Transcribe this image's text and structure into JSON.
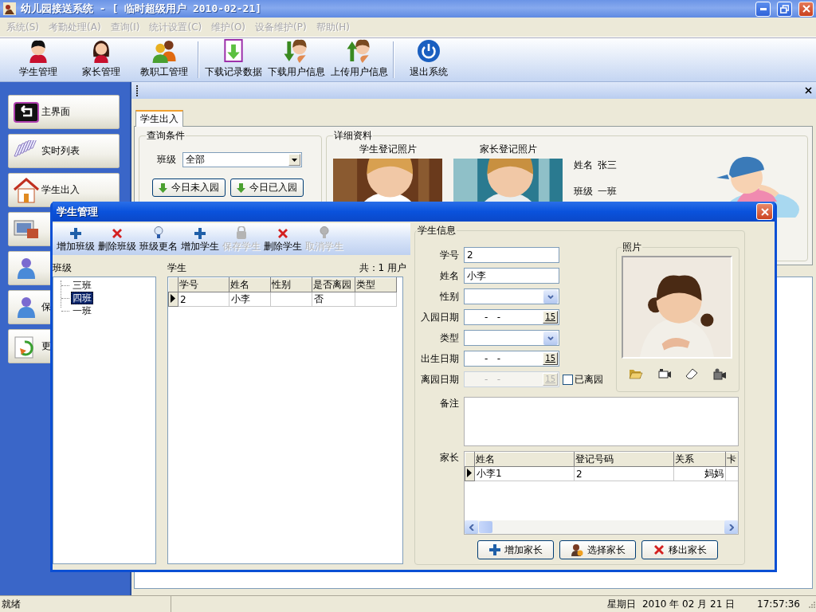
{
  "window": {
    "title": "幼儿园接送系统 - [ 临时超级用户 2010-02-21]"
  },
  "menu": [
    {
      "label": "系统(S)",
      "disabled": true
    },
    {
      "label": "考勤处理(A)",
      "disabled": true
    },
    {
      "label": "查询(I)",
      "disabled": true
    },
    {
      "label": "统计设置(C)",
      "disabled": true
    },
    {
      "label": "维护(O)",
      "disabled": true
    },
    {
      "label": "设备维护(P)",
      "disabled": true
    },
    {
      "label": "帮助(H)",
      "disabled": true
    }
  ],
  "toolbar": [
    {
      "kind": "person",
      "label": "学生管理"
    },
    {
      "kind": "woman",
      "label": "家长管理"
    },
    {
      "kind": "people",
      "label": "教职工管理"
    },
    {
      "kind": "separator"
    },
    {
      "kind": "document-download",
      "label": "下载记录数据"
    },
    {
      "kind": "person-download",
      "label": "下载用户信息"
    },
    {
      "kind": "person-upload",
      "label": "上传用户信息"
    },
    {
      "kind": "separator"
    },
    {
      "kind": "power",
      "label": "退出系统"
    }
  ],
  "sidebar": [
    {
      "kind": "back",
      "label": "主界面"
    },
    {
      "kind": "list",
      "label": "实时列表"
    },
    {
      "kind": "house",
      "label": "学生出入"
    },
    {
      "kind": "computer"
    },
    {
      "kind": "figure"
    },
    {
      "kind": "figure",
      "label": "保"
    },
    {
      "kind": "refresh",
      "label": "更"
    }
  ],
  "form": {
    "tab": {
      "label": "学生出入",
      "selected": true
    },
    "query": {
      "title": "查询条件",
      "class_label": "班级",
      "class_value": "全部",
      "buttons": [
        "今日未入园",
        "今日已入园"
      ]
    },
    "details": {
      "title": "详细资料",
      "photo_captions": [
        "学生登记照片",
        "家长登记照片"
      ],
      "fields": [
        {
          "label": "姓名",
          "value": "张三"
        },
        {
          "label": "班级",
          "value": "一班"
        }
      ]
    }
  },
  "dialog": {
    "title": "学生管理",
    "toolbar": [
      {
        "kind": "add",
        "label": "增加班级",
        "disabled": false
      },
      {
        "kind": "delete",
        "label": "删除班级",
        "disabled": false
      },
      {
        "kind": "rename",
        "label": "班级更名",
        "disabled": false
      },
      {
        "kind": "add",
        "label": "增加学生",
        "disabled": false
      },
      {
        "kind": "save",
        "label": "保存学生",
        "disabled": true
      },
      {
        "kind": "delete",
        "label": "删除学生",
        "disabled": false
      },
      {
        "kind": "rename",
        "label": "取消学生",
        "disabled": true
      }
    ],
    "classes": {
      "title": "班级",
      "items": [
        {
          "label": "三班",
          "selected": false
        },
        {
          "label": "四班",
          "selected": true
        },
        {
          "label": "一班",
          "selected": false
        }
      ]
    },
    "students": {
      "title": "学生",
      "count": "共：1 用户",
      "columns": [
        "学号",
        "姓名",
        "性别",
        "是否离园",
        "类型"
      ],
      "rows": [
        {
          "cells": [
            "2",
            "小李",
            null,
            "否",
            null
          ],
          "selected": true
        }
      ]
    },
    "info": {
      "title": "学生信息",
      "fields": [
        {
          "kind": "text",
          "label": "学号",
          "value": "2",
          "disabled": false
        },
        {
          "kind": "text",
          "label": "姓名",
          "value": "小李",
          "disabled": false
        },
        {
          "kind": "select",
          "label": "性别",
          "disabled": false
        },
        {
          "kind": "date",
          "label": "入园日期",
          "value": "-   -",
          "button": "15",
          "disabled": false
        },
        {
          "kind": "select",
          "label": "类型",
          "disabled": false
        },
        {
          "kind": "date",
          "label": "出生日期",
          "value": "-   -",
          "button": "15",
          "disabled": false
        },
        {
          "kind": "date",
          "label": "离园日期",
          "value": "-   -",
          "button": "15",
          "disabled": true
        }
      ],
      "left_checkbox": {
        "label": "已离园",
        "checked": false
      },
      "photo_title": "照片",
      "notes_label": "备注",
      "parents": {
        "label": "家长",
        "columns": [
          "姓名",
          "登记号码",
          "关系",
          "卡"
        ],
        "rows": [
          {
            "cells": [
              "小李1",
              "2",
              "妈妈",
              null
            ],
            "selected": true
          }
        ]
      },
      "buttons": [
        {
          "kind": "add",
          "label": "增加家长"
        },
        {
          "kind": "choose",
          "label": "选择家长"
        },
        {
          "kind": "remove",
          "label": "移出家长"
        }
      ]
    }
  },
  "status_bar": {
    "text": "就绪",
    "date": "星期日  2010 年 02 月 21 日",
    "time": "17:57:36"
  }
}
